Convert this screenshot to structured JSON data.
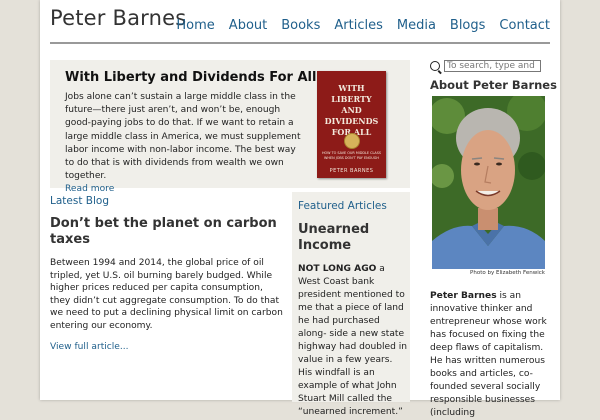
{
  "site": {
    "title": "Peter Barnes",
    "nav": [
      "Home",
      "About",
      "Books",
      "Articles",
      "Media",
      "Blogs",
      "Contact"
    ]
  },
  "hero": {
    "title": "With Liberty and Dividends For All",
    "text": "Jobs alone can’t sustain a large middle class in the future—there just aren’t, and won’t be, enough good-paying jobs to do that. If we want to retain a large middle class in America, we must supplement labor income with non-labor income. The best way to do that is with dividends from wealth we own together.",
    "read_more": "Read more",
    "book": {
      "title": "WITH LIBERTY AND DIVIDENDS FOR ALL",
      "subtitle": "HOW TO SAVE OUR MIDDLE CLASS WHEN JOBS DON’T PAY ENOUGH",
      "author": "PETER BARNES"
    }
  },
  "latest": {
    "label": "Latest Blog",
    "title": "Don’t bet the planet on carbon taxes",
    "text": "Between 1994 and 2014, the global price of oil tripled, yet U.S. oil burning barely budged. While higher prices reduced per capita consumption, they didn’t cut aggregate consumption. To do that we need to put a declining physical limit on carbon entering our economy.",
    "link": "View full article..."
  },
  "featured": {
    "label": "Featured Articles",
    "title": "Unearned Income",
    "lead": "NOT LONG AGO",
    "text": " a West Coast bank president mentioned to me that a piece of land he had purchased along- side a new state highway had doubled in value in a few years.  His windfall is an example of what John Stuart Mill called the “unearned increment.”"
  },
  "sidebar": {
    "search_placeholder": "To search, type and hi",
    "about_title": "About Peter Barnes",
    "photo_credit": "Photo by Elizabeth Fenwick",
    "bio_name": "Peter Barnes",
    "bio_text": " is an innovative thinker and entrepreneur whose work has focused on fixing the deep flaws of capitalism.  He has written numerous books and articles, co-founded several socially responsible businesses (including"
  }
}
